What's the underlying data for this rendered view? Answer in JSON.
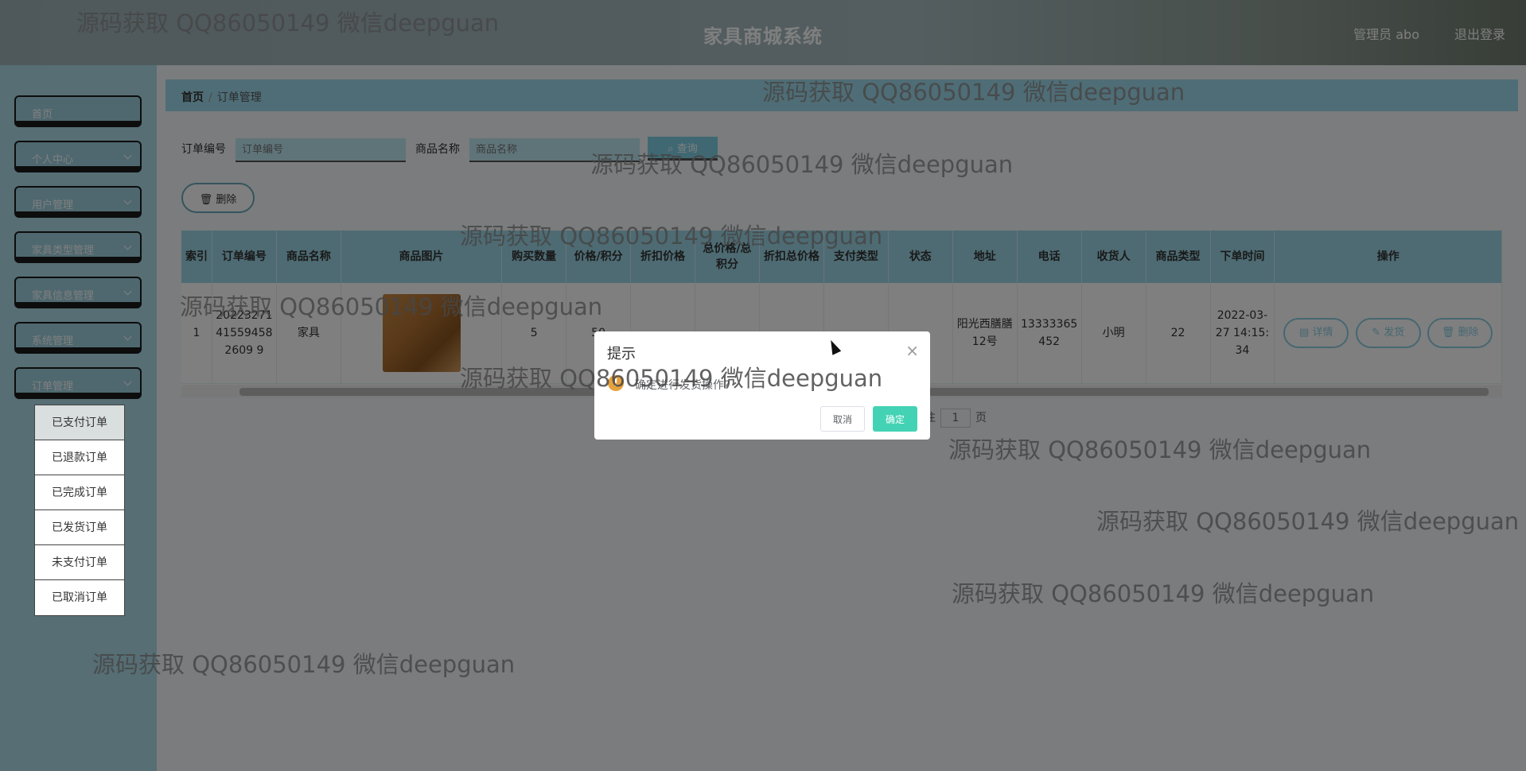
{
  "header": {
    "title": "家具商城系统",
    "user": "管理员 abo",
    "logout": "退出登录"
  },
  "sidebar": {
    "items": [
      {
        "label": "首页"
      },
      {
        "label": "个人中心"
      },
      {
        "label": "用户管理"
      },
      {
        "label": "家具类型管理"
      },
      {
        "label": "家具信息管理"
      },
      {
        "label": "系统管理"
      },
      {
        "label": "订单管理"
      }
    ],
    "submenu": [
      "已支付订单",
      "已退款订单",
      "已完成订单",
      "已发货订单",
      "未支付订单",
      "已取消订单"
    ],
    "active_submenu": "已支付订单"
  },
  "breadcrumb": {
    "home": "首页",
    "current": "订单管理"
  },
  "search": {
    "order_label": "订单编号",
    "order_placeholder": "订单编号",
    "product_label": "商品名称",
    "product_placeholder": "商品名称",
    "query_button": "查询"
  },
  "toolbar": {
    "delete_button": "删除"
  },
  "table": {
    "headers": [
      "索引",
      "订单编号",
      "商品名称",
      "商品图片",
      "购买数量",
      "价格/积分",
      "折扣价格",
      "总价格/总积分",
      "折扣总价格",
      "支付类型",
      "状态",
      "地址",
      "电话",
      "收货人",
      "商品类型",
      "下单时间",
      "操作"
    ],
    "rows": [
      {
        "index": "1",
        "order_no": "20223271415594582609 9",
        "product": "家具",
        "quantity": "5",
        "price": "50",
        "discount_price": "",
        "total": "",
        "discount_total": "",
        "pay_type": "",
        "status": "",
        "address": "阳光西膳膳12号",
        "phone": "13333365452",
        "receiver": "小明",
        "type": "22",
        "time": "2022-03-27 14:15:34"
      }
    ],
    "actions": {
      "detail": "详情",
      "ship": "发货",
      "delete": "删除"
    }
  },
  "pager": {
    "prefix": "往",
    "page": "1",
    "suffix": "页"
  },
  "dialog": {
    "title": "提示",
    "message": "确定进行发货操作?",
    "cancel": "取消",
    "confirm": "确定"
  },
  "watermark": "源码获取 QQ86050149 微信deepguan"
}
